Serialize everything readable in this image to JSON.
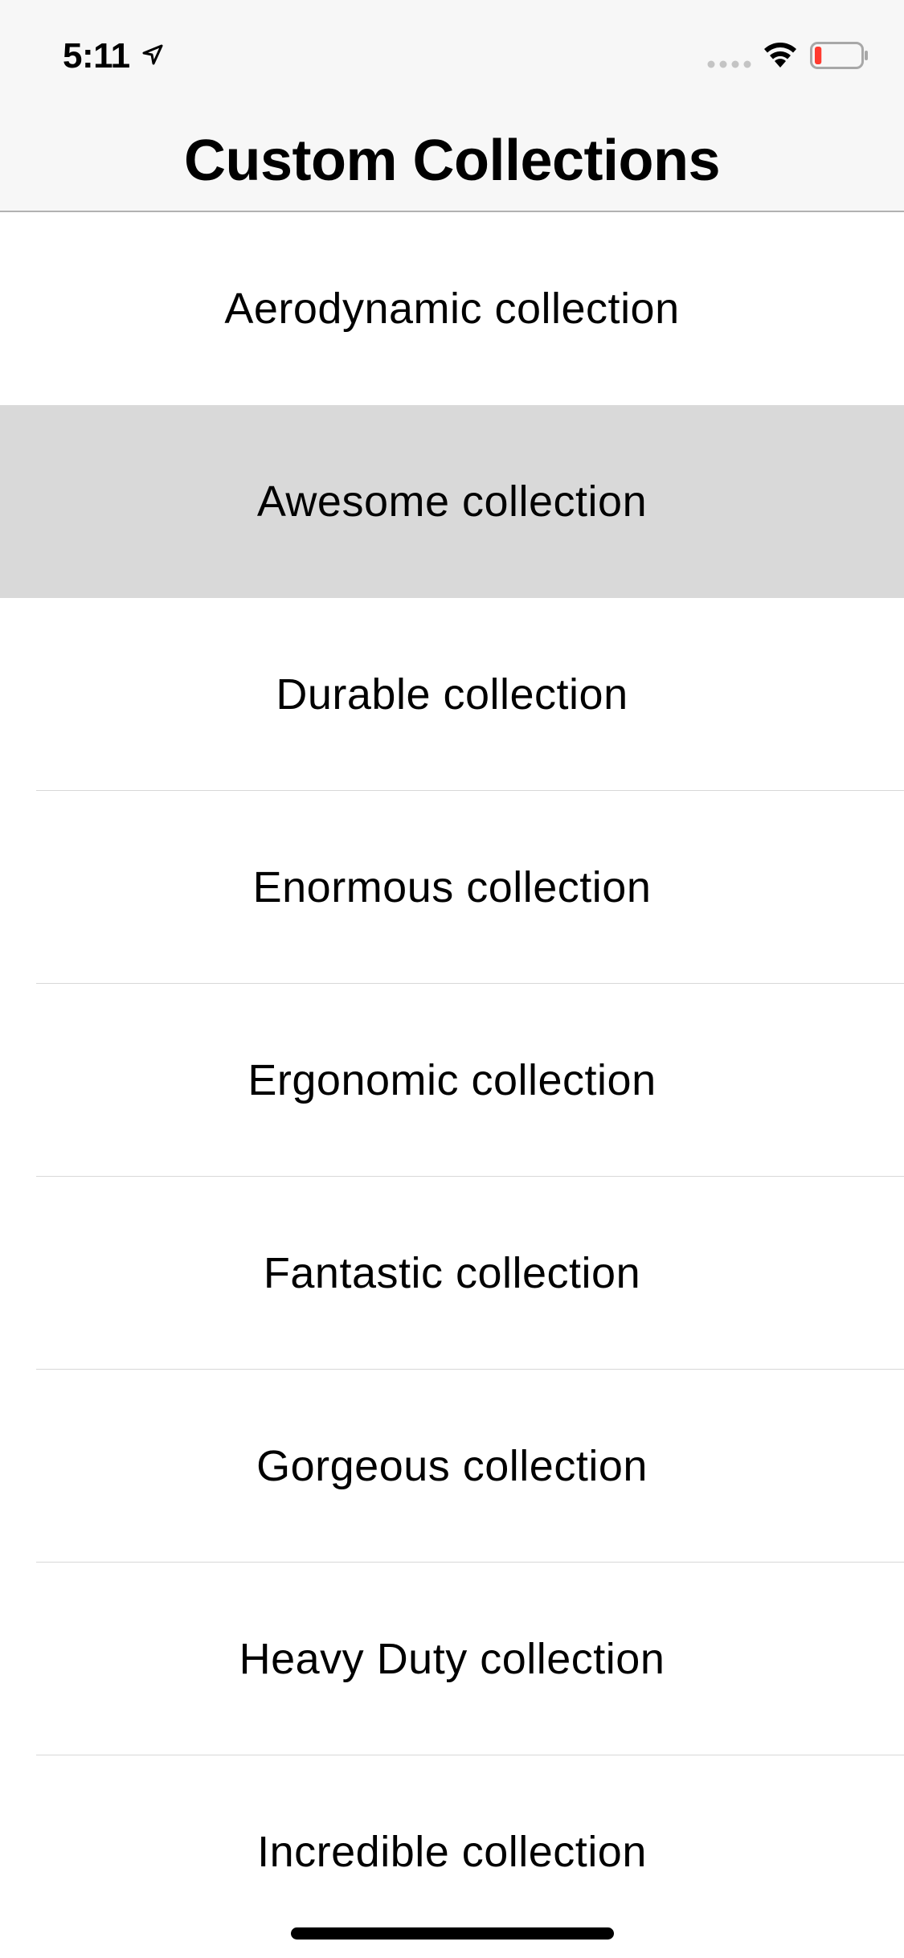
{
  "status_bar": {
    "time": "5:11",
    "icons": [
      "location-arrow-icon",
      "cellular-signal-icon",
      "wifi-icon",
      "battery-low-icon"
    ],
    "battery_level": 0.15,
    "battery_color": "#ff3b30"
  },
  "nav": {
    "title": "Custom Collections"
  },
  "list": {
    "selected_index": 1,
    "selected_background": "#d9d9d9",
    "items": [
      {
        "label": "Aerodynamic collection"
      },
      {
        "label": "Awesome collection"
      },
      {
        "label": "Durable collection"
      },
      {
        "label": "Enormous collection"
      },
      {
        "label": "Ergonomic collection"
      },
      {
        "label": "Fantastic collection"
      },
      {
        "label": "Gorgeous collection"
      },
      {
        "label": "Heavy Duty collection"
      },
      {
        "label": "Incredible collection"
      }
    ]
  }
}
